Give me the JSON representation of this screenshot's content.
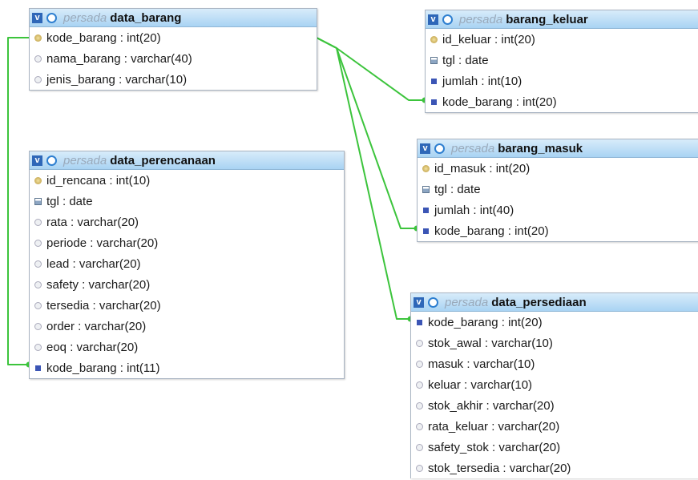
{
  "tables": [
    {
      "id": "data_barang",
      "db": "persada",
      "name": "data_barang",
      "columns": [
        {
          "name": "kode_barang : int(20)",
          "kind": "key"
        },
        {
          "name": "nama_barang : varchar(40)",
          "kind": "plain"
        },
        {
          "name": "jenis_barang : varchar(10)",
          "kind": "plain"
        }
      ]
    },
    {
      "id": "data_perencanaan",
      "db": "persada",
      "name": "data_perencanaan",
      "columns": [
        {
          "name": "id_rencana : int(10)",
          "kind": "key"
        },
        {
          "name": "tgl : date",
          "kind": "date"
        },
        {
          "name": "rata : varchar(20)",
          "kind": "plain"
        },
        {
          "name": "periode : varchar(20)",
          "kind": "plain"
        },
        {
          "name": "lead : varchar(20)",
          "kind": "plain"
        },
        {
          "name": "safety : varchar(20)",
          "kind": "plain"
        },
        {
          "name": "tersedia : varchar(20)",
          "kind": "plain"
        },
        {
          "name": "order : varchar(20)",
          "kind": "plain"
        },
        {
          "name": "eoq : varchar(20)",
          "kind": "plain"
        },
        {
          "name": "kode_barang : int(11)",
          "kind": "num"
        }
      ]
    },
    {
      "id": "barang_keluar",
      "db": "persada",
      "name": "barang_keluar",
      "columns": [
        {
          "name": "id_keluar : int(20)",
          "kind": "key"
        },
        {
          "name": "tgl : date",
          "kind": "date"
        },
        {
          "name": "jumlah : int(10)",
          "kind": "num"
        },
        {
          "name": "kode_barang : int(20)",
          "kind": "num"
        }
      ]
    },
    {
      "id": "barang_masuk",
      "db": "persada",
      "name": "barang_masuk",
      "columns": [
        {
          "name": "id_masuk : int(20)",
          "kind": "key"
        },
        {
          "name": "tgl : date",
          "kind": "date"
        },
        {
          "name": "jumlah : int(40)",
          "kind": "num"
        },
        {
          "name": "kode_barang : int(20)",
          "kind": "num"
        }
      ]
    },
    {
      "id": "data_persediaan",
      "db": "persada",
      "name": "data_persediaan",
      "columns": [
        {
          "name": "kode_barang : int(20)",
          "kind": "num"
        },
        {
          "name": "stok_awal : varchar(10)",
          "kind": "plain"
        },
        {
          "name": "masuk : varchar(10)",
          "kind": "plain"
        },
        {
          "name": "keluar : varchar(10)",
          "kind": "plain"
        },
        {
          "name": "stok_akhir : varchar(20)",
          "kind": "plain"
        },
        {
          "name": "rata_keluar : varchar(20)",
          "kind": "plain"
        },
        {
          "name": "safety_stok : varchar(20)",
          "kind": "plain"
        },
        {
          "name": "stok_tersedia : varchar(20)",
          "kind": "plain"
        }
      ]
    }
  ],
  "colors": {
    "link": "#3cc43c",
    "header_top": "#d8ecfa",
    "header_bottom": "#a9d3f3"
  },
  "icons": {
    "toggle": "v",
    "key": "key-icon",
    "date": "date-icon",
    "num": "number-icon",
    "plain": "column-icon"
  }
}
